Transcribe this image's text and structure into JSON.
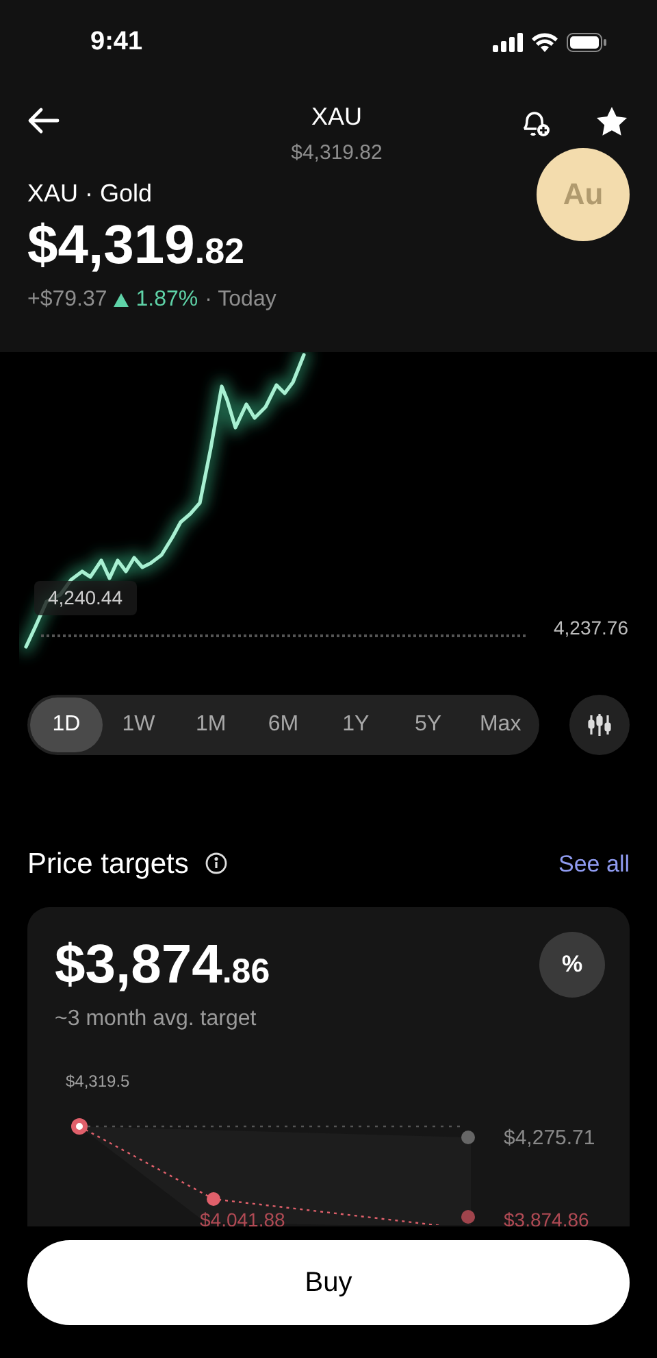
{
  "status_bar": {
    "time": "9:41"
  },
  "header": {
    "title": "XAU",
    "subtitle": "$4,319.82"
  },
  "asset": {
    "name": "XAU · Gold",
    "price_whole": "$4,319",
    "price_cents": ".82",
    "change": "+$79.37",
    "percent": "1.87%",
    "rising": true,
    "period": "· Today",
    "logo_text": "Au"
  },
  "chart": {
    "high_label": "4,240.44",
    "baseline_label": "4,237.76"
  },
  "ranges": [
    {
      "label": "1D",
      "selected": true
    },
    {
      "label": "1W",
      "selected": false
    },
    {
      "label": "1M",
      "selected": false
    },
    {
      "label": "6M",
      "selected": false
    },
    {
      "label": "1Y",
      "selected": false
    },
    {
      "label": "5Y",
      "selected": false
    },
    {
      "label": "Max",
      "selected": false
    }
  ],
  "price_targets": {
    "title": "Price targets",
    "link": "See all",
    "value_whole": "$3,874",
    "value_cents": ".86",
    "caption": "~3 month avg. target",
    "toggle": "%",
    "current_label": "$4,319.5",
    "high_label": "$4,275.71",
    "mid_label": "$4,041.88",
    "low_label": "$3,874.86"
  },
  "buy_button": "Buy"
}
